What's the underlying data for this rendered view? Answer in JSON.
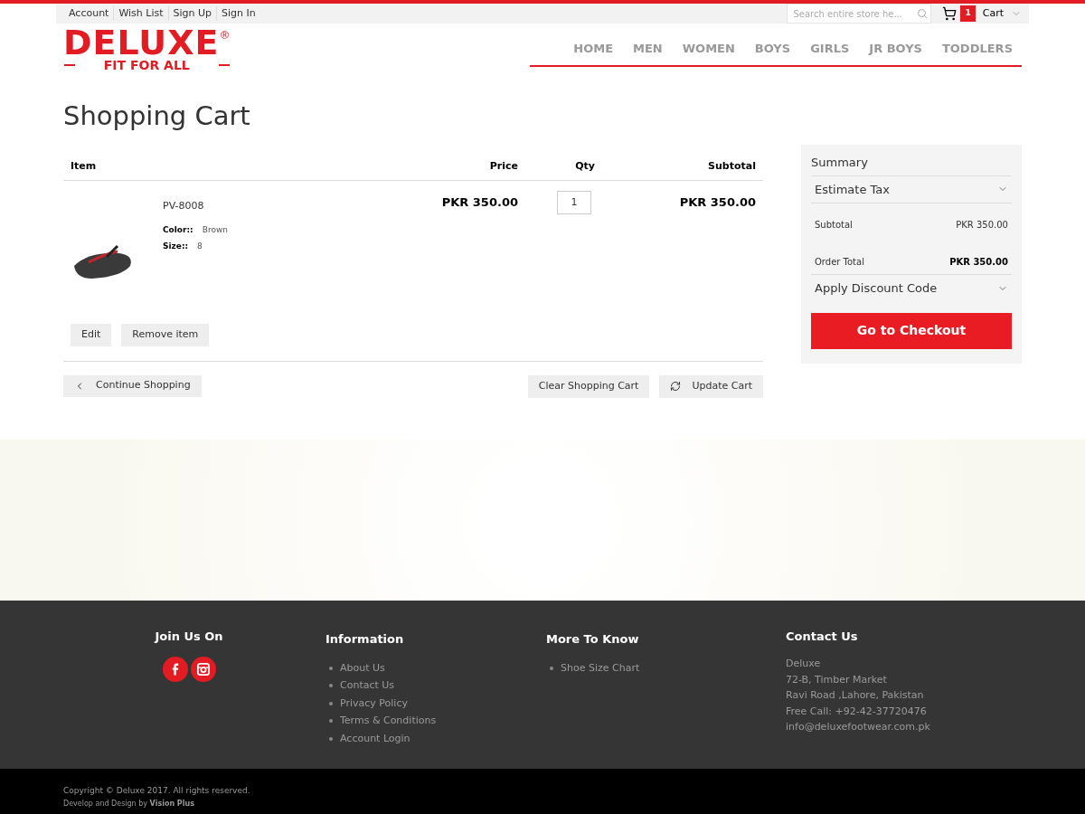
{
  "top_links": [
    "Account",
    "Wish List",
    "Sign Up",
    "Sign In"
  ],
  "search": {
    "placeholder": "Search entire store he..."
  },
  "cart": {
    "count": "1",
    "label": "Cart"
  },
  "logo": {
    "name": "DELUXE",
    "mark": "®",
    "tagline": "FIT FOR ALL"
  },
  "nav": [
    "HOME",
    "MEN",
    "WOMEN",
    "BOYS",
    "GIRLS",
    "JR BOYS",
    "TODDLERS"
  ],
  "page_title": "Shopping Cart",
  "table": {
    "columns": [
      "Item",
      "Price",
      "Qty",
      "Subtotal"
    ],
    "rows": [
      {
        "name": "PV-8008",
        "options": [
          {
            "label": "Color::",
            "value": "Brown"
          },
          {
            "label": "Size::",
            "value": "8"
          }
        ],
        "price": "PKR 350.00",
        "qty": "1",
        "subtotal": "PKR 350.00",
        "actions": [
          "Edit",
          "Remove item"
        ]
      }
    ]
  },
  "cart_actions": {
    "continue": "Continue Shopping",
    "clear": "Clear Shopping Cart",
    "update": "Update Cart"
  },
  "summary": {
    "title": "Summary",
    "estimate": "Estimate Tax",
    "lines": [
      {
        "label": "Subtotal",
        "value": "PKR 350.00",
        "kind": "normal"
      },
      {
        "label": "Order Total",
        "value": "PKR 350.00",
        "kind": "total"
      }
    ],
    "discount": "Apply Discount Code",
    "checkout": "Go to Checkout"
  },
  "footer": {
    "social_title": "Join Us On",
    "info_title": "Information",
    "info_links": [
      "About Us",
      "Contact Us",
      "Privacy Policy",
      "Terms & Conditions",
      "Account Login"
    ],
    "more_title": "More To Know",
    "more_links": [
      "Shoe Size Chart"
    ],
    "contact_title": "Contact Us",
    "contact_lines": [
      "Deluxe",
      "72-B, Timber Market",
      "Ravi Road ,Lahore, Pakistan",
      "Free Call: +92-42-37720476",
      "info@deluxefootwear.com.pk"
    ]
  },
  "copyright": "Copyright © Deluxe 2017. All rights reserved.",
  "credit": "Develop and Design by **Vision Plus**"
}
